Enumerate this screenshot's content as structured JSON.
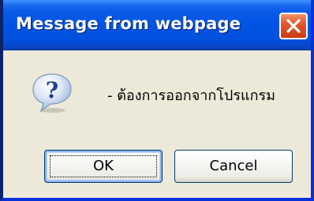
{
  "dialog": {
    "title": "Message from webpage",
    "message": "- ต้องการออกจากโปรแกรม",
    "icon": "question-icon",
    "buttons": {
      "ok_label": "OK",
      "cancel_label": "Cancel"
    },
    "close_icon": "close-icon"
  },
  "colors": {
    "titlebar": "#0054e3",
    "body": "#ece9d8",
    "close_button": "#e2582d",
    "button_border": "#003c74"
  }
}
